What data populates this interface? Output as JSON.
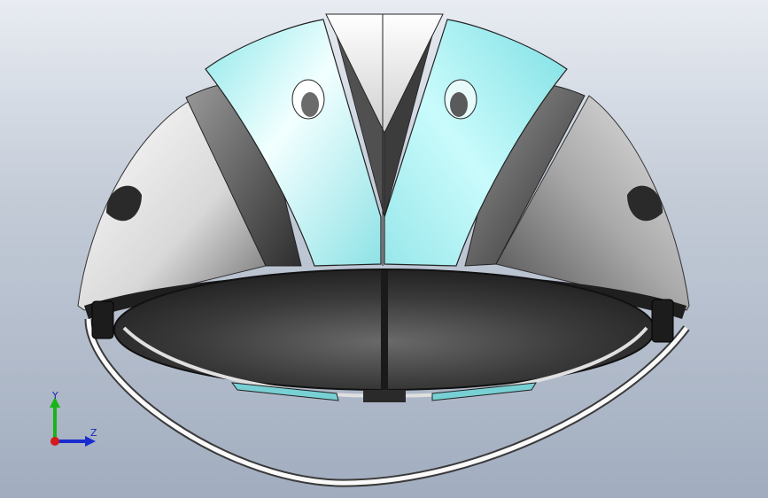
{
  "triad": {
    "y_label": "Y",
    "z_label": "Z",
    "y_color": "#19b419",
    "z_color": "#1a2bd0",
    "x_color": "#d41a1a"
  },
  "colors": {
    "shell_white": "#f4f4f4",
    "shell_grey": "#8a8a8a",
    "accent_cyan": "#9fe9ec",
    "liner_dark": "#2d2d2d"
  }
}
